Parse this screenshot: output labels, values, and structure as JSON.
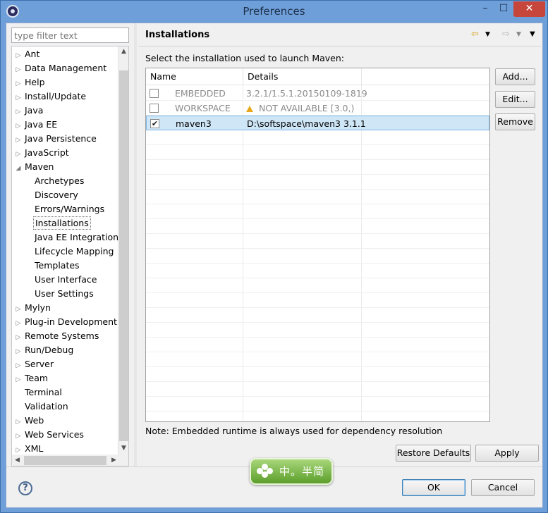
{
  "window": {
    "title": "Preferences",
    "controls": {
      "minimize": "–",
      "maximize": "☐",
      "close": "✕"
    }
  },
  "sidebar": {
    "filter_placeholder": "type filter text",
    "items": [
      {
        "label": "Ant",
        "level": 0,
        "expandable": true
      },
      {
        "label": "Data Management",
        "level": 0,
        "expandable": true
      },
      {
        "label": "Help",
        "level": 0,
        "expandable": true
      },
      {
        "label": "Install/Update",
        "level": 0,
        "expandable": true
      },
      {
        "label": "Java",
        "level": 0,
        "expandable": true
      },
      {
        "label": "Java EE",
        "level": 0,
        "expandable": true
      },
      {
        "label": "Java Persistence",
        "level": 0,
        "expandable": true
      },
      {
        "label": "JavaScript",
        "level": 0,
        "expandable": true
      },
      {
        "label": "Maven",
        "level": 0,
        "expandable": true,
        "expanded": true
      },
      {
        "label": "Archetypes",
        "level": 1
      },
      {
        "label": "Discovery",
        "level": 1
      },
      {
        "label": "Errors/Warnings",
        "level": 1
      },
      {
        "label": "Installations",
        "level": 1,
        "selected": true
      },
      {
        "label": "Java EE Integration",
        "level": 1
      },
      {
        "label": "Lifecycle Mapping",
        "level": 1
      },
      {
        "label": "Templates",
        "level": 1
      },
      {
        "label": "User Interface",
        "level": 1
      },
      {
        "label": "User Settings",
        "level": 1
      },
      {
        "label": "Mylyn",
        "level": 0,
        "expandable": true
      },
      {
        "label": "Plug-in Development",
        "level": 0,
        "expandable": true
      },
      {
        "label": "Remote Systems",
        "level": 0,
        "expandable": true
      },
      {
        "label": "Run/Debug",
        "level": 0,
        "expandable": true
      },
      {
        "label": "Server",
        "level": 0,
        "expandable": true
      },
      {
        "label": "Team",
        "level": 0,
        "expandable": true
      },
      {
        "label": "Terminal",
        "level": 0,
        "expandable": false
      },
      {
        "label": "Validation",
        "level": 0,
        "expandable": false
      },
      {
        "label": "Web",
        "level": 0,
        "expandable": true
      },
      {
        "label": "Web Services",
        "level": 0,
        "expandable": true
      },
      {
        "label": "XML",
        "level": 0,
        "expandable": true
      }
    ]
  },
  "main": {
    "title": "Installations",
    "instruction": "Select the installation used to launch Maven:",
    "table": {
      "columns": [
        "Name",
        "Details"
      ],
      "rows": [
        {
          "checked": false,
          "name": "EMBEDDED",
          "details": "3.2.1/1.5.1.20150109-1819",
          "disabled": true,
          "warning": false
        },
        {
          "checked": false,
          "name": "WORKSPACE",
          "details": "NOT AVAILABLE [3.0,)",
          "disabled": true,
          "warning": true
        },
        {
          "checked": true,
          "name": "maven3",
          "details": "D:\\softspace\\maven3 3.1.1",
          "disabled": false,
          "warning": false,
          "selected": true
        }
      ]
    },
    "buttons": {
      "add": "Add...",
      "edit": "Edit...",
      "remove": "Remove"
    },
    "note": "Note: Embedded runtime is always used for dependency resolution",
    "restore_defaults": "Restore Defaults",
    "apply": "Apply"
  },
  "footer": {
    "help": "?",
    "ok": "OK",
    "cancel": "Cancel"
  },
  "watermark": {
    "text": "中。半简"
  },
  "colors": {
    "selection": "#cfe6f7",
    "titlebar": "#6f9fd9",
    "close": "#c7463b",
    "warning": "#e9a81b"
  }
}
